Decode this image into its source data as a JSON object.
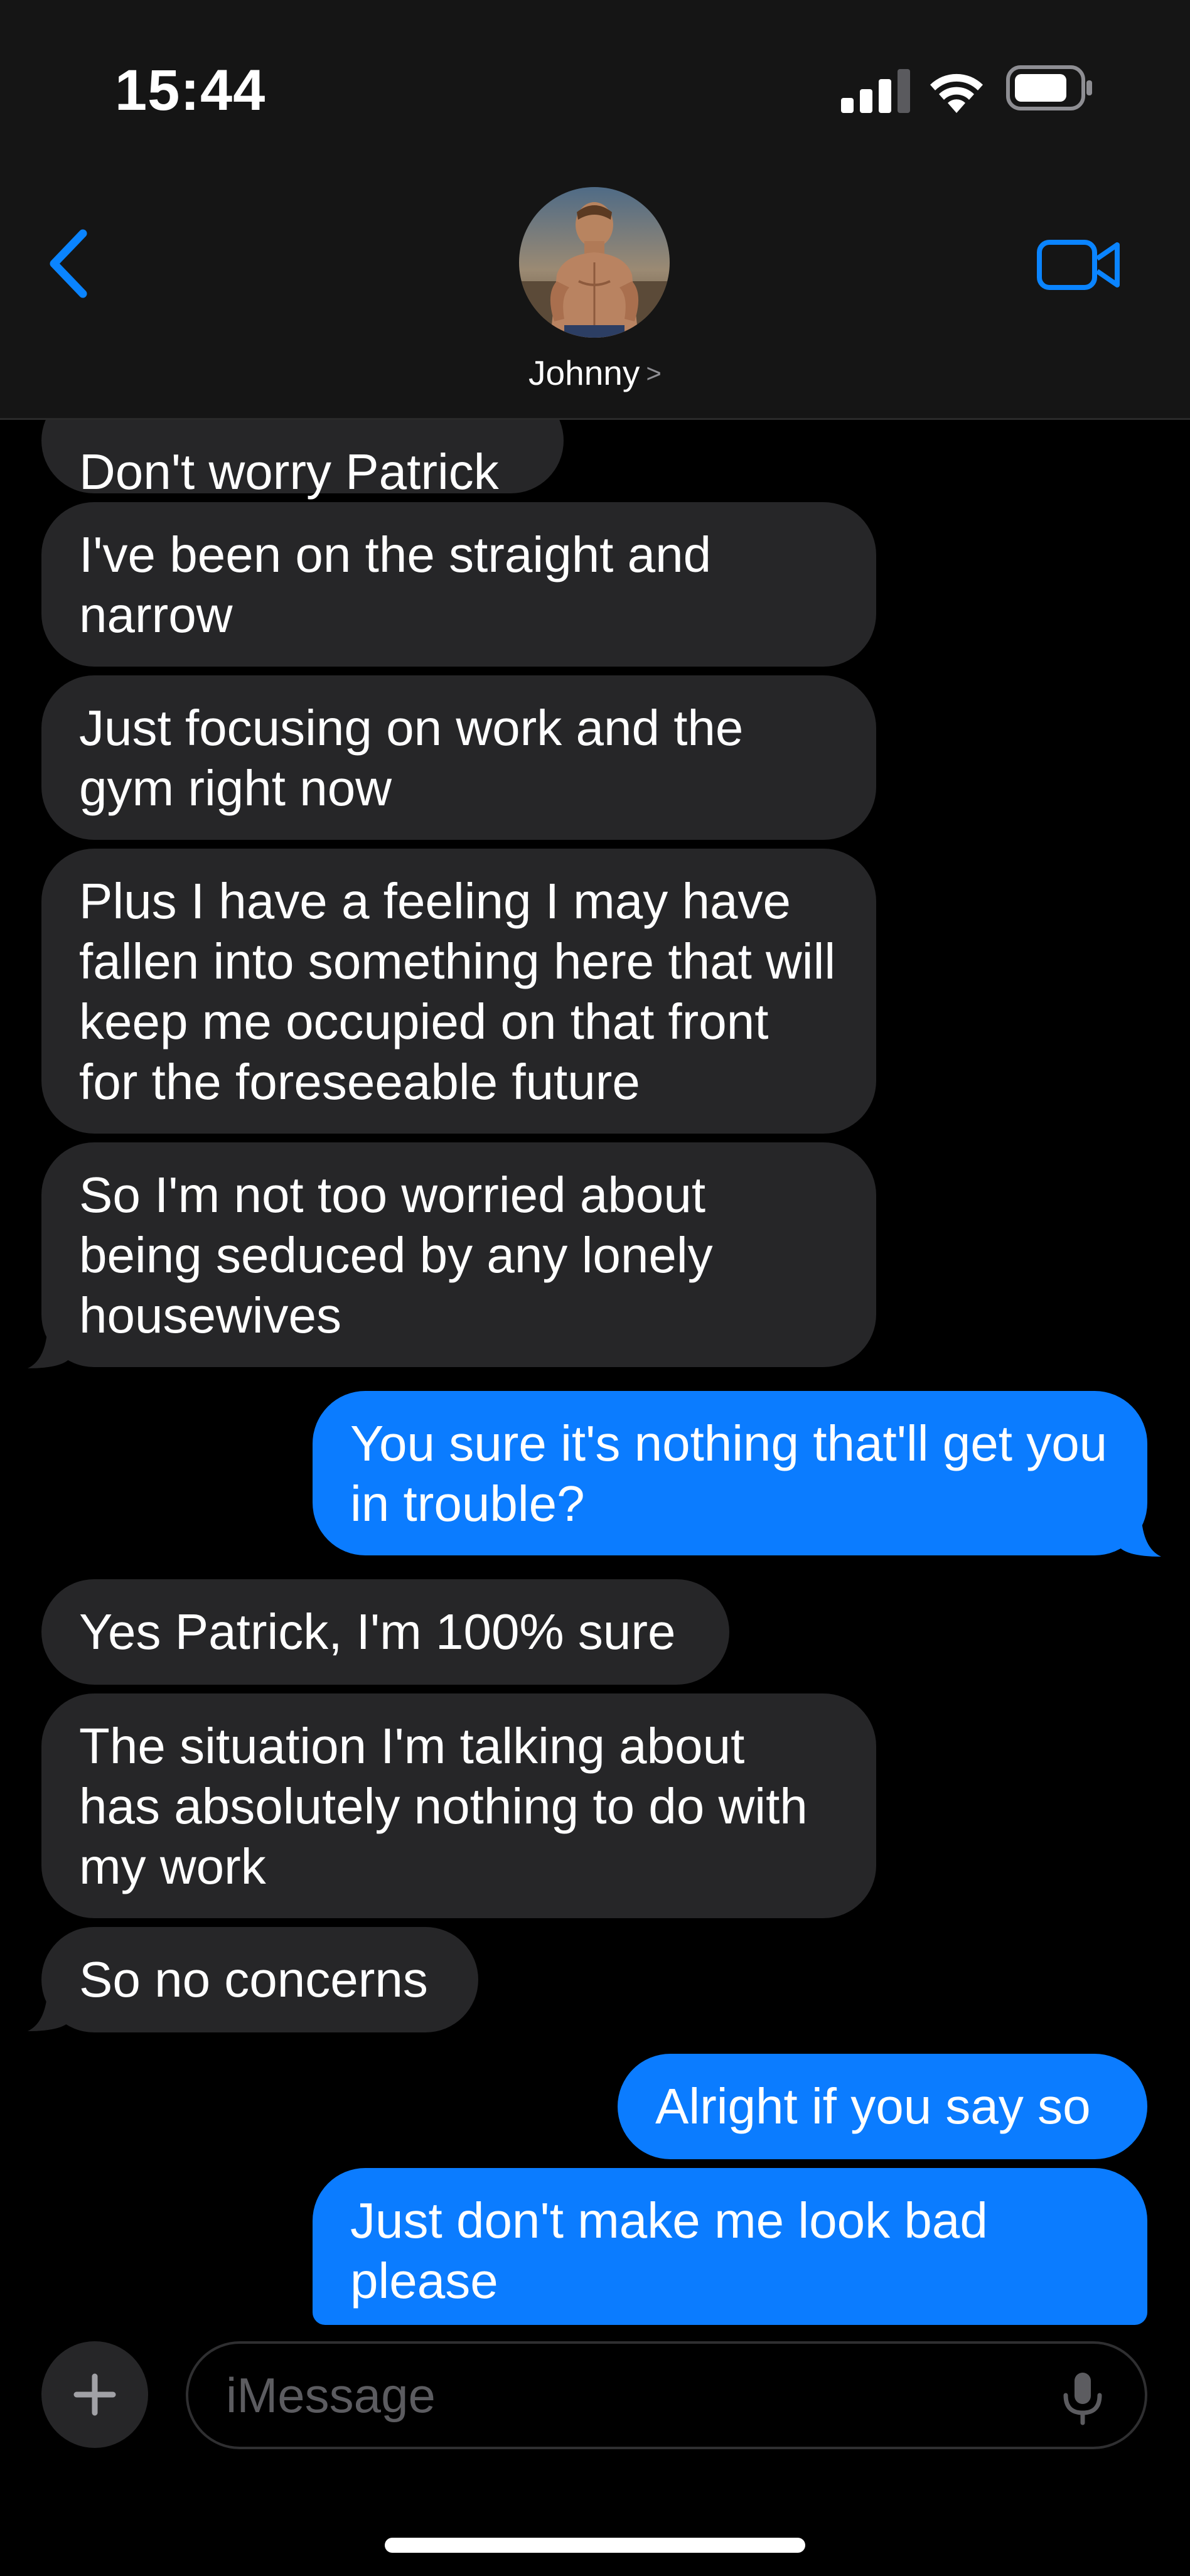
{
  "status_bar": {
    "time": "15:44",
    "signal_icon": "cellular-signal-icon",
    "wifi_icon": "wifi-icon",
    "battery_icon": "battery-icon"
  },
  "header": {
    "back_icon": "chevron-left-icon",
    "contact_name": "Johnny",
    "contact_chevron": ">",
    "video_icon": "video-camera-icon",
    "accent_color": "#0a84ff"
  },
  "messages": [
    {
      "direction": "incoming",
      "text": "Don't worry Patrick"
    },
    {
      "direction": "incoming",
      "text": "I've been on the straight and narrow"
    },
    {
      "direction": "incoming",
      "text": "Just focusing on work and the gym right now"
    },
    {
      "direction": "incoming",
      "text": "Plus I have a feeling I may have fallen into something here that will keep me occupied on that front for the foreseeable future"
    },
    {
      "direction": "incoming",
      "text": "So I'm not too worried about being seduced by any lonely housewives"
    },
    {
      "direction": "outgoing",
      "text": "You sure it's nothing that'll get you in trouble?"
    },
    {
      "direction": "incoming",
      "text": "Yes Patrick, I'm 100% sure"
    },
    {
      "direction": "incoming",
      "text": "The situation I'm talking about has absolutely nothing to do with my work"
    },
    {
      "direction": "incoming",
      "text": "So no concerns"
    },
    {
      "direction": "outgoing",
      "text": "Alright if you say so"
    },
    {
      "direction": "outgoing",
      "text": "Just don't make me look bad please"
    }
  ],
  "colors": {
    "incoming_bubble": "#262628",
    "outgoing_bubble": "#0b7cff",
    "header_background": "#151515"
  },
  "composer": {
    "plus_icon": "plus-icon",
    "placeholder": "iMessage",
    "mic_icon": "microphone-icon"
  }
}
